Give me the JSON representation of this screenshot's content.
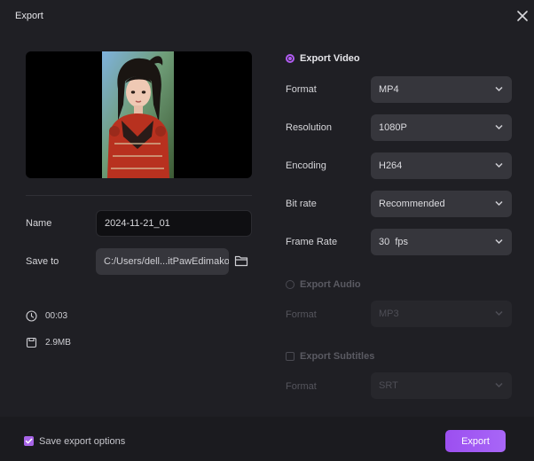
{
  "dialog": {
    "title": "Export"
  },
  "left": {
    "name_label": "Name",
    "name_value": "2024-11-21_01",
    "saveto_label": "Save to",
    "saveto_value": "C:/Users/dell...itPawEdimakor",
    "duration": "00:03",
    "filesize": "2.9MB"
  },
  "video": {
    "heading": "Export Video",
    "selected": true,
    "rows": [
      {
        "label": "Format",
        "value": "MP4"
      },
      {
        "label": "Resolution",
        "value": "1080P"
      },
      {
        "label": "Encoding",
        "value": "H264"
      },
      {
        "label": "Bit rate",
        "value": "Recommended"
      },
      {
        "label": "Frame Rate",
        "value": "30  fps"
      }
    ]
  },
  "audio": {
    "heading": "Export Audio",
    "selected": false,
    "format_label": "Format",
    "format_value": "MP3"
  },
  "subtitles": {
    "heading": "Export Subtitles",
    "checked": false,
    "format_label": "Format",
    "format_value": "SRT"
  },
  "footer": {
    "save_options_label": "Save export options",
    "save_options_checked": true,
    "export_label": "Export"
  },
  "colors": {
    "accent": "#a865e8",
    "background": "#1f1f24",
    "field": "#36363c"
  }
}
